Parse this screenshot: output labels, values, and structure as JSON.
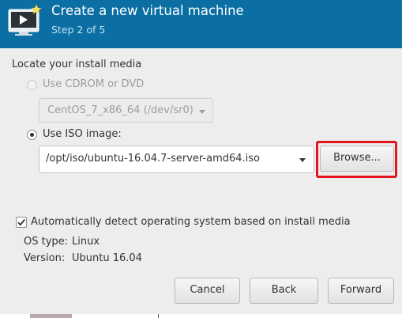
{
  "header": {
    "title": "Create a new virtual machine",
    "step": "Step 2 of 5",
    "icon": "virtual-machine-monitor-icon",
    "background_color": "#0b6fa4"
  },
  "install_media": {
    "section_title": "Locate your install media",
    "cdrom_option": {
      "label": "Use CDROM or DVD",
      "selected": false,
      "enabled": false
    },
    "cdrom_device": {
      "selected_value": "CentOS_7_x86_64 (/dev/sr0)",
      "enabled": false
    },
    "iso_option": {
      "label": "Use ISO image:",
      "selected": true
    },
    "iso_path": {
      "value": "/opt/iso/ubuntu-16.04.7-server-amd64.iso"
    },
    "browse_button": {
      "label": "Browse...",
      "highlight_color": "#e3161d"
    }
  },
  "os_detection": {
    "auto_detect_label": "Automatically detect operating system based on install media",
    "auto_detect_checked": true,
    "os_type_label": "OS type:",
    "os_type_value": "Linux",
    "version_label": "Version:",
    "version_value": "Ubuntu 16.04"
  },
  "footer": {
    "cancel_label": "Cancel",
    "back_label": "Back",
    "forward_label": "Forward"
  }
}
